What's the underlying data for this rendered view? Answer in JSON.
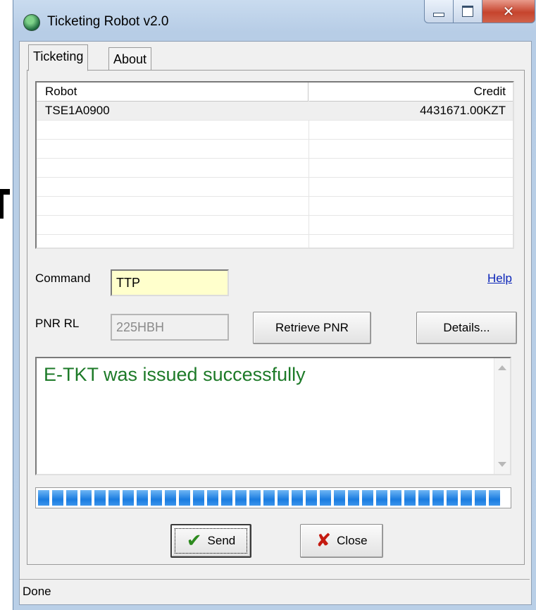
{
  "window": {
    "title": "Ticketing Robot v2.0",
    "caption_buttons": [
      "minimize",
      "maximize",
      "close"
    ]
  },
  "tabs": [
    {
      "label": "Ticketing",
      "active": true
    },
    {
      "label": "About",
      "active": false
    }
  ],
  "robot_table": {
    "columns": [
      "Robot",
      "Credit"
    ],
    "rows": [
      {
        "robot": "TSE1A0900",
        "credit": "4431671.00KZT"
      }
    ]
  },
  "command": {
    "label": "Command",
    "value": "TTP"
  },
  "pnr": {
    "label": "PNR RL",
    "value": "225HBH"
  },
  "help_link": "Help",
  "buttons": {
    "retrieve_pnr": "Retrieve PNR",
    "details": "Details...",
    "send": "Send",
    "close": "Close"
  },
  "output": {
    "message": "E-TKT was issued successfully",
    "message_color": "#1d7a28"
  },
  "progress": {
    "fraction": 1.0,
    "color": "#1a7ce0"
  },
  "status": "Done",
  "icons": {
    "app": "app-globe-icon",
    "send": "checkmark-icon",
    "close": "red-x-icon"
  }
}
